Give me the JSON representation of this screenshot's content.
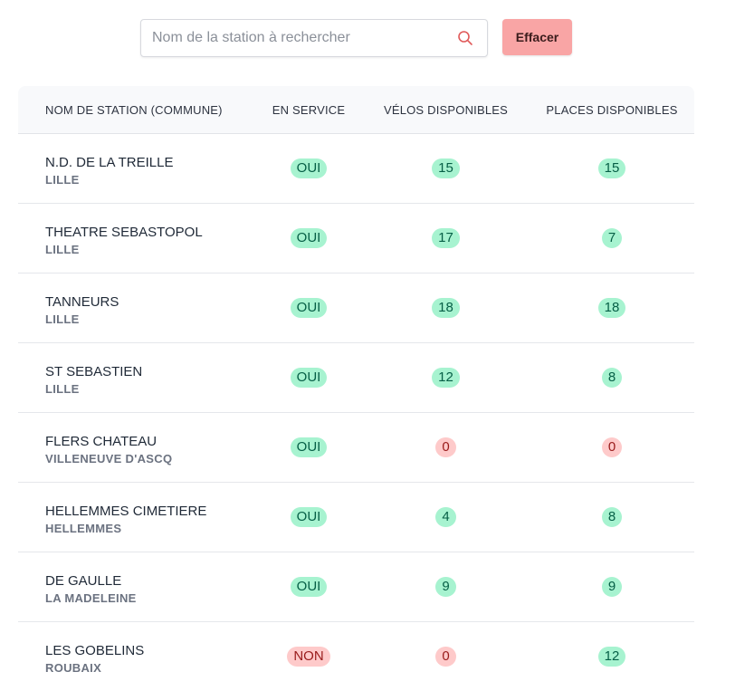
{
  "search": {
    "placeholder": "Nom de la station à rechercher",
    "value": ""
  },
  "clear_button": {
    "label": "Effacer"
  },
  "colors": {
    "accent": "#f9a5a5",
    "ok_bg": "#a7f3d0",
    "ok_text": "#065f46",
    "no_bg": "#fecaca",
    "no_text": "#991b1b"
  },
  "table": {
    "headers": {
      "name": "NOM DE STATION (COMMUNE)",
      "service": "EN SERVICE",
      "velos": "VÉLOS DISPONIBLES",
      "places": "PLACES DISPONIBLES"
    },
    "rows": [
      {
        "name": "N.D. DE LA TREILLE",
        "commune": "LILLE",
        "service": "OUI",
        "velos": "15",
        "places": "15"
      },
      {
        "name": "THEATRE SEBASTOPOL",
        "commune": "LILLE",
        "service": "OUI",
        "velos": "17",
        "places": "7"
      },
      {
        "name": "TANNEURS",
        "commune": "LILLE",
        "service": "OUI",
        "velos": "18",
        "places": "18"
      },
      {
        "name": "ST SEBASTIEN",
        "commune": "LILLE",
        "service": "OUI",
        "velos": "12",
        "places": "8"
      },
      {
        "name": "FLERS CHATEAU",
        "commune": "VILLENEUVE D'ASCQ",
        "service": "OUI",
        "velos": "0",
        "places": "0"
      },
      {
        "name": "HELLEMMES CIMETIERE",
        "commune": "HELLEMMES",
        "service": "OUI",
        "velos": "4",
        "places": "8"
      },
      {
        "name": "DE GAULLE",
        "commune": "LA MADELEINE",
        "service": "OUI",
        "velos": "9",
        "places": "9"
      },
      {
        "name": "LES GOBELINS",
        "commune": "ROUBAIX",
        "service": "NON",
        "velos": "0",
        "places": "12"
      }
    ]
  }
}
